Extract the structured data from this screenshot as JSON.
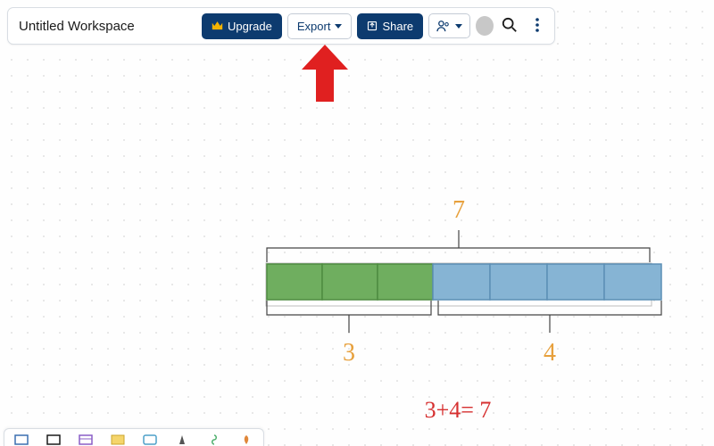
{
  "header": {
    "workspace_title": "Untitled Workspace",
    "upgrade_label": "Upgrade",
    "export_label": "Export",
    "share_label": "Share"
  },
  "icons": {
    "crown": "crown-icon",
    "export_dropdown": "chevron-down-icon",
    "share_box": "share-icon",
    "collab": "collab-icon",
    "search": "search-icon",
    "more": "more-vertical-icon"
  },
  "annotation": {
    "arrow_color": "#e02020"
  },
  "diagram": {
    "top_label": "7",
    "left_label": "3",
    "right_label": "4",
    "equation": "3+4= 7",
    "colors": {
      "green": "#6fae5f",
      "green_border": "#4e8c40",
      "blue": "#86b4d4",
      "blue_border": "#5c8fb5",
      "bracket": "#444444",
      "top_label_color": "#e7a03c",
      "bottom_label_color": "#e7a03c",
      "equation_color": "#d63030"
    },
    "green_count": 3,
    "blue_count": 4
  },
  "bottom_tools": [
    {
      "name": "tool-1"
    },
    {
      "name": "tool-2"
    },
    {
      "name": "tool-3"
    },
    {
      "name": "tool-4"
    },
    {
      "name": "tool-5"
    },
    {
      "name": "tool-6"
    },
    {
      "name": "tool-7"
    },
    {
      "name": "tool-8"
    }
  ]
}
